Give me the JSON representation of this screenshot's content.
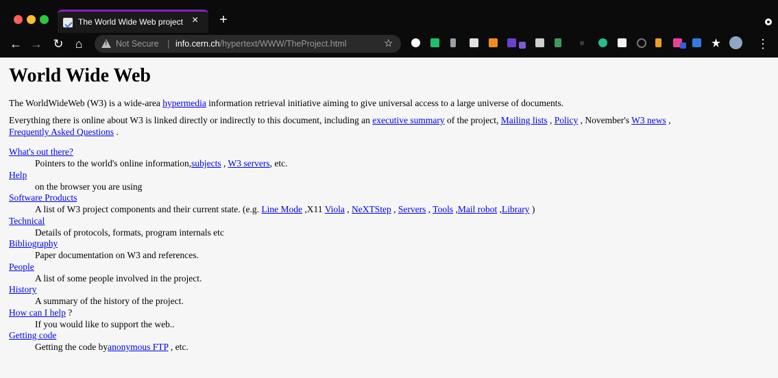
{
  "browser": {
    "tab_title": "The World Wide Web project",
    "tab_close": "×",
    "new_tab": "+",
    "not_secure": "Not Secure",
    "url_separator": "|",
    "url_host": "info.cern.ch",
    "url_path": "/hypertext/WWW/TheProject.html",
    "nav": {
      "back": "←",
      "forward": "→",
      "reload": "↻",
      "home": "⌂",
      "star": "☆",
      "menu": "⋮"
    },
    "colors": {
      "close": "#ff5f57",
      "minimize": "#febc2e",
      "zoom": "#28c840",
      "tab_accent": "#8a1ec2"
    }
  },
  "page": {
    "title": "World Wide Web",
    "intro": {
      "t1": "The WorldWideWeb (W3) is a wide-area",
      "link_hypermedia": "hypermedia",
      "t2": " information retrieval initiative aiming to give universal access to a large universe of documents."
    },
    "overview": {
      "t1": "Everything there is online about W3 is linked directly or indirectly to this document, including an ",
      "link_exec": "executive summary",
      "t2": " of the project, ",
      "link_mailing": "Mailing lists",
      "t3": " , ",
      "link_policy": "Policy",
      "t4": " , November's ",
      "link_news": "W3 news",
      "t5": " , ",
      "link_faq": "Frequently Asked Questions",
      "t6": " ."
    },
    "sections": {
      "whats_out_there": {
        "title": "What's out there?",
        "d1": "Pointers to the world's online information,",
        "link_subjects": "subjects",
        "d2": " , ",
        "link_servers": "W3 servers",
        "d3": ", etc."
      },
      "help": {
        "title": "Help",
        "desc": "on the browser you are using"
      },
      "software": {
        "title": "Software Products",
        "d1": "A list of W3 project components and their current state. (e.g. ",
        "link_linemode": "Line Mode",
        "d2": " ,X11 ",
        "link_viola": "Viola",
        "d3": " , ",
        "link_nextstep": "NeXTStep",
        "d4": " , ",
        "link_servers": "Servers",
        "d5": " , ",
        "link_tools": "Tools",
        "d6": " ,",
        "link_mailrobot": "Mail robot",
        "d7": " ,",
        "link_library": "Library",
        "d8": " )"
      },
      "technical": {
        "title": "Technical",
        "desc": "Details of protocols, formats, program internals etc"
      },
      "bibliography": {
        "title": "Bibliography",
        "desc": "Paper documentation on W3 and references."
      },
      "people": {
        "title": "People",
        "desc": "A list of some people involved in the project."
      },
      "history": {
        "title": "History",
        "desc": "A summary of the history of the project."
      },
      "how_help": {
        "title": "How can I help",
        "suffix": " ?",
        "desc": "If you would like to support the web.."
      },
      "getting_code": {
        "title": "Getting code",
        "d1": "Getting the code by",
        "link_ftp": "anonymous FTP",
        "d2": " , etc."
      }
    },
    "colors": {
      "link": "#0000ee",
      "text": "#000000",
      "background": "#f6f6f6"
    }
  }
}
